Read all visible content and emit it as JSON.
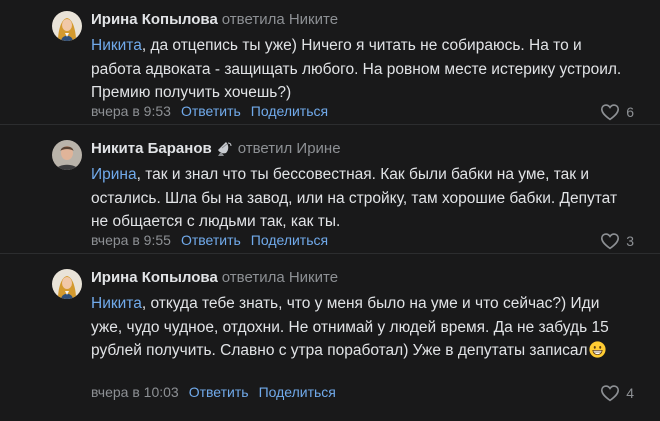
{
  "comments": [
    {
      "author": "Ирина Копылова",
      "replied": "ответила Никите",
      "mention": "Никита",
      "text": ", да отцепись ты уже) Ничего я читать не собираюсь. На то и работа адвоката - защищать любого. На ровном месте истерику устроил. Премию получить хочешь?)",
      "time": "вчера в 9:53",
      "reply_label": "Ответить",
      "share_label": "Поделиться",
      "likes": "6",
      "avatar_icon": "woman-avatar-icon"
    },
    {
      "author": "Никита Баранов",
      "replied": "ответил Ирине",
      "mention": "Ирина",
      "text": ", так и знал что ты бессовестная. Как были бабки на уме, так и остались. Шла бы на завод, или на стройку, там хорошие бабки. Депутат не общается с людьми так, как ты.",
      "time": "вчера в 9:55",
      "reply_label": "Ответить",
      "share_label": "Поделиться",
      "likes": "3",
      "avatar_icon": "man-avatar-icon",
      "badge_icon": "satellite-dish-icon"
    },
    {
      "author": "Ирина Копылова",
      "replied": "ответила Никите",
      "mention": "Никита",
      "text": ", откуда тебе знать, что у меня было на уме и что сейчас?) Иди уже, чудо чудное, отдохни. Не отнимай у людей время. Да не забудь 15 рублей получить. Славно с утра поработал) Уже в депутаты записал",
      "emoji_icon": "grinning-face-emoji",
      "time": "вчера в 10:03",
      "reply_label": "Ответить",
      "share_label": "Поделиться",
      "likes": "4",
      "avatar_icon": "woman-avatar-icon"
    }
  ],
  "colors": {
    "background": "#19191a",
    "text": "#e1e3e6",
    "secondary": "#8d9094",
    "accent": "#71aaeb",
    "divider": "#2c2d2f"
  }
}
